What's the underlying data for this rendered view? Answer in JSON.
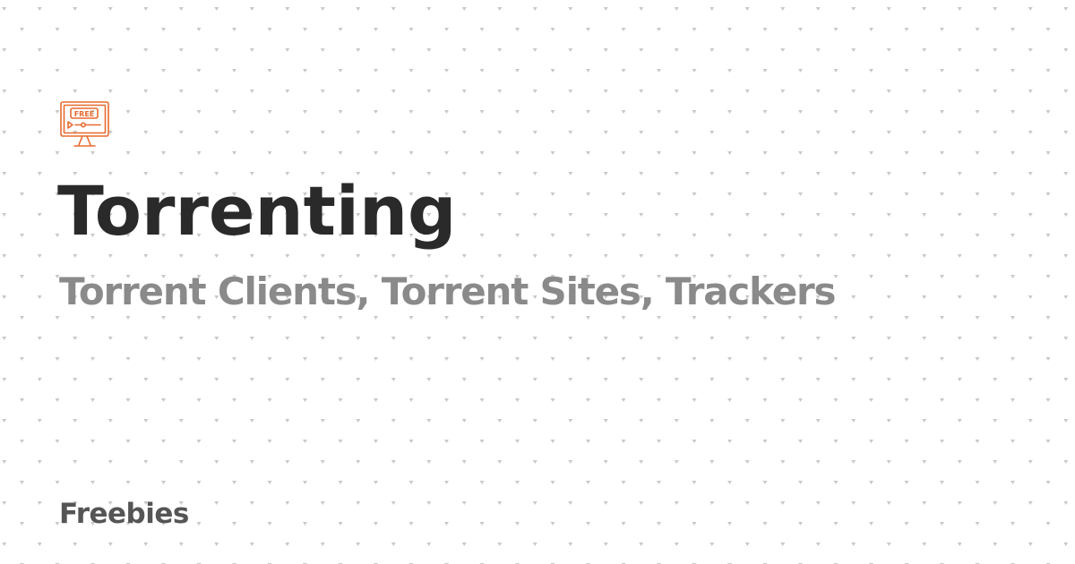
{
  "logo": {
    "icon": "free-monitor-icon",
    "text": "FREE",
    "color": "#e86a2e"
  },
  "title": "Torrenting",
  "subtitle": "Torrent Clients, Torrent Sites, Trackers",
  "footer": {
    "label": "Freebies"
  },
  "colors": {
    "background": "#ffffff",
    "dots": "#c9c9c9",
    "title": "#2a2a2a",
    "subtitle": "#8a8a8a",
    "footer": "#555555"
  }
}
